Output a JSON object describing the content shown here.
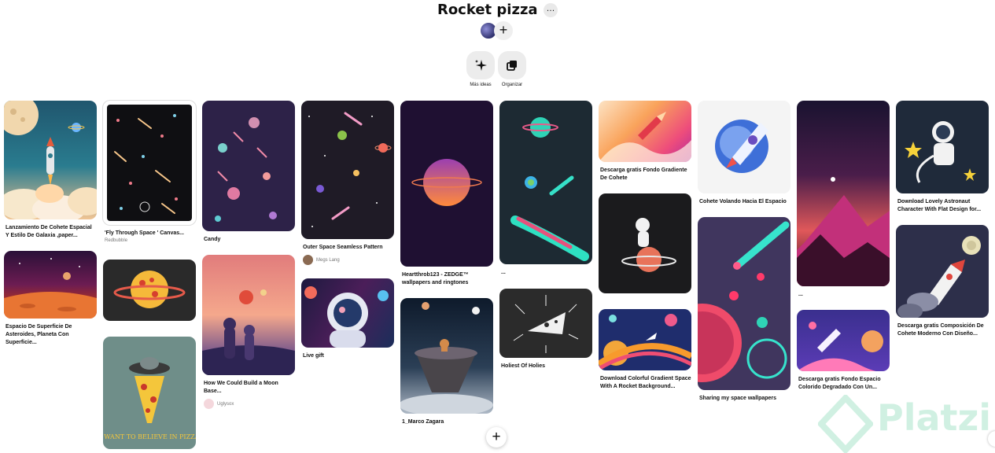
{
  "board": {
    "title": "Rocket pizza",
    "more_icon": "…",
    "add_icon": "+"
  },
  "actions": [
    {
      "label": "Más ideas",
      "icon": "sparkle-icon"
    },
    {
      "label": "Organizar",
      "icon": "organize-icon"
    }
  ],
  "pins": [
    {
      "title": "Lanzamiento De Cohete Espacial Y Estilo De Galaxia ,paper...",
      "sub": ""
    },
    {
      "title": "Espacio De Superficie De Asteroides, Planeta Con Superficie...",
      "sub": ""
    },
    {
      "title": "'Fly Through Space ' Canvas...",
      "sub": "Redbubble"
    },
    {
      "title": "",
      "sub": ""
    },
    {
      "title": "",
      "sub": ""
    },
    {
      "title": "Candy",
      "sub": ""
    },
    {
      "title": "How We Could Build a Moon Base...",
      "user": "Uglysox"
    },
    {
      "title": "Outer Space Seamless Pattern",
      "user": "Megs Lang"
    },
    {
      "title": "Live gift",
      "sub": ""
    },
    {
      "title": "Heartthrob123 - ZEDGE™ wallpapers and ringtones",
      "sub": ""
    },
    {
      "title": "1_Marco Zagara",
      "sub": ""
    },
    {
      "title": "...",
      "sub": ""
    },
    {
      "title": "Holiest Of Holies",
      "sub": ""
    },
    {
      "title": "Descarga gratis Fondo Gradiente De Cohete",
      "sub": ""
    },
    {
      "title": "",
      "sub": ""
    },
    {
      "title": "Download Colorful Gradient Space With A Rocket Background...",
      "sub": ""
    },
    {
      "title": "Cohete Volando Hacia El Espacio",
      "sub": ""
    },
    {
      "title": "Sharing my space wallpapers",
      "sub": ""
    },
    {
      "title": "...",
      "sub": ""
    },
    {
      "title": "Descarga gratis Fondo Espacio Colorido Degradado Con Un...",
      "sub": ""
    },
    {
      "title": "Download Lovely Astronaut Character With Flat Design for...",
      "sub": ""
    },
    {
      "title": "Descarga gratis Composición De Cohete Moderno Con Diseño...",
      "sub": ""
    }
  ],
  "fab": {
    "icon": "+"
  },
  "watermark": {
    "text": "Platzi"
  },
  "colors": {
    "accent": "#e60023",
    "button_bg": "#efefef"
  }
}
